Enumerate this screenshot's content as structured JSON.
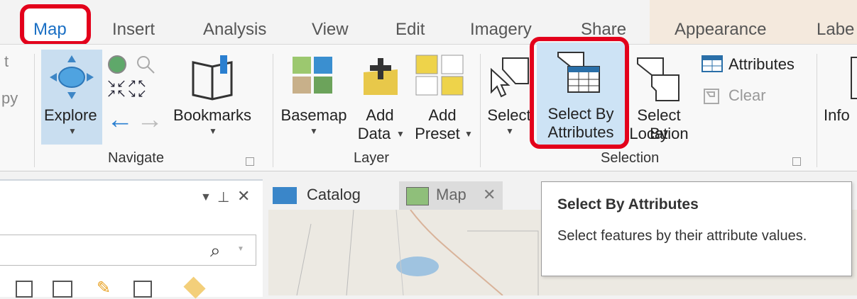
{
  "tabs": [
    "Map",
    "Insert",
    "Analysis",
    "View",
    "Edit",
    "Imagery",
    "Share",
    "Appearance",
    "Labe"
  ],
  "ribbon": {
    "clip_left_top": "t",
    "clip_left_mid": "py",
    "navigate": {
      "explore_label": "Explore",
      "bookmarks_label": "Bookmarks",
      "group_label": "Navigate"
    },
    "layer": {
      "basemap_label": "Basemap",
      "add_data_label_1": "Add",
      "add_data_label_2": "Data",
      "add_preset_label_1": "Add",
      "add_preset_label_2": "Preset",
      "group_label": "Layer"
    },
    "selection": {
      "select_label": "Select",
      "select_by_attributes_1": "Select By",
      "select_by_attributes_2": "Attributes",
      "select_by_location_1": "Select By",
      "select_by_location_2": "Location",
      "attributes_label": "Attributes",
      "clear_label": "Clear",
      "group_label": "Selection"
    },
    "info_label": "Info"
  },
  "panes": {
    "catalog_tab": "Catalog",
    "map_tab": "Map",
    "search_icon_glyph": "⌕"
  },
  "tooltip": {
    "title": "Select By Attributes",
    "body": "Select features by their attribute values."
  },
  "colors": {
    "highlight_red": "#e3001b",
    "selected_bg": "#cde3f5",
    "accent_blue": "#1a6fc4"
  }
}
